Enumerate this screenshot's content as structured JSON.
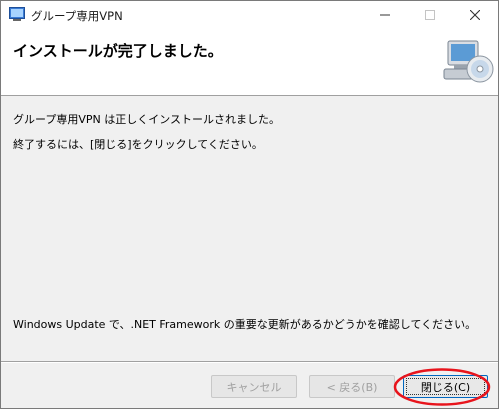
{
  "window": {
    "title": "グループ専用VPN",
    "icons": [
      "app-icon",
      "minimize-icon",
      "maximize-icon",
      "close-icon"
    ]
  },
  "banner": {
    "title": "インストールが完了しました。",
    "icon": "computer-cd-icon"
  },
  "body": {
    "message1": "グループ専用VPN は正しくインストールされました。",
    "message2": "終了するには、[閉じる]をクリックしてください。",
    "message3": "Windows Update で、.NET Framework の重要な更新があるかどうかを確認してください。"
  },
  "footer": {
    "cancel_label": "キャンセル",
    "back_label": "< 戻る(B)",
    "close_label": "閉じる(C)"
  },
  "annotation": {
    "highlight_color": "#e8141c"
  }
}
